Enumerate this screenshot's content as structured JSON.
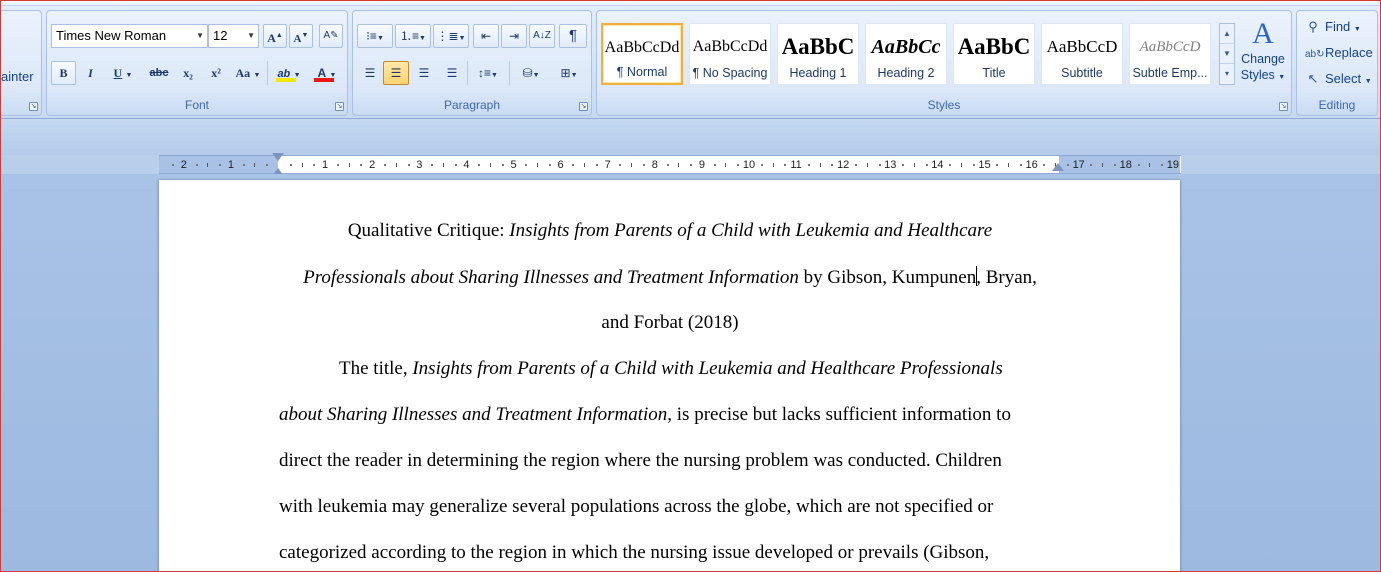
{
  "ribbon": {
    "clipboard": {
      "partial_label": "ainter"
    },
    "font": {
      "label": "Font",
      "font_name": "Times New Roman",
      "font_size": "12",
      "grow": "A",
      "shrink": "A",
      "bold": "B",
      "italic": "I",
      "underline": "U",
      "strike": "abc",
      "subscript": "x₂",
      "superscript": "x²",
      "case": "Aa",
      "highlight": "ab",
      "font_color": "A",
      "highlight_color": "#f5e800",
      "font_color_value": "#e81818"
    },
    "paragraph": {
      "label": "Paragraph"
    },
    "styles": {
      "label": "Styles",
      "tiles": [
        {
          "preview": "AaBbCcDd",
          "name": "¶ Normal"
        },
        {
          "preview": "AaBbCcDd",
          "name": "¶ No Spacing"
        },
        {
          "preview": "AaBbC",
          "name": "Heading 1"
        },
        {
          "preview": "AaBbCc",
          "name": "Heading 2"
        },
        {
          "preview": "AaBbC",
          "name": "Title"
        },
        {
          "preview": "AaBbCcD",
          "name": "Subtitle"
        },
        {
          "preview": "AaBbCcD",
          "name": "Subtle Emp..."
        }
      ],
      "change_styles_1": "Change",
      "change_styles_2": "Styles"
    },
    "editing": {
      "label": "Editing",
      "find": "Find",
      "replace": "Replace",
      "select": "Select"
    }
  },
  "ruler": {
    "left_numbers": [
      "2",
      "1"
    ],
    "right_numbers": [
      "1",
      "2",
      "3",
      "4",
      "5",
      "6",
      "7",
      "8",
      "9",
      "10",
      "11",
      "12",
      "13",
      "14",
      "15",
      "16",
      "17",
      "18",
      "19"
    ]
  },
  "document": {
    "title_line1_plain": "Qualitative Critique: ",
    "title_line1_italic": "Insights from Parents of a Child with Leukemia and Healthcare",
    "title_line2_italic": "Professionals about Sharing Illnesses and Treatment Information",
    "title_line2_plain_a": " by Gibson, Kumpunen",
    "title_line2_plain_b": " Bryan,",
    "title_line3": "and Forbat (2018)",
    "para_line1_plain": "The title, ",
    "para_line1_italic": "Insights from Parents of a Child with Leukemia and Healthcare Professionals",
    "para_line2_italic": "about Sharing Illnesses and Treatment Information",
    "para_line2_plain": ", is precise but lacks sufficient information to",
    "para_line3": "direct the reader in determining the region where the nursing problem was conducted. Children",
    "para_line4": "with leukemia may generalize several populations across the globe, which are not specified or",
    "para_line5": "categorized according to the region in which the nursing issue developed or prevails (Gibson,"
  }
}
